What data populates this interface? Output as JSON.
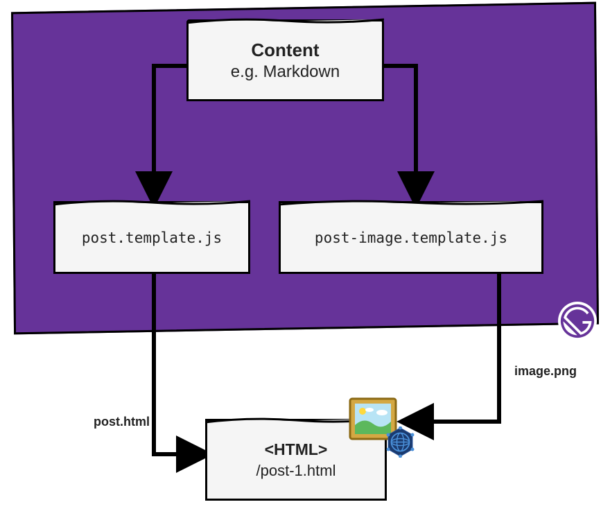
{
  "content_box": {
    "title": "Content",
    "subtitle": "e.g. Markdown"
  },
  "template_left": "post.template.js",
  "template_right": "post-image.template.js",
  "output": {
    "title": "<HTML>",
    "path": "/post-1.html"
  },
  "labels": {
    "left_arrow": "post.html",
    "right_arrow": "image.png"
  },
  "colors": {
    "purple": "#663399",
    "box_bg": "#f5f5f5"
  }
}
